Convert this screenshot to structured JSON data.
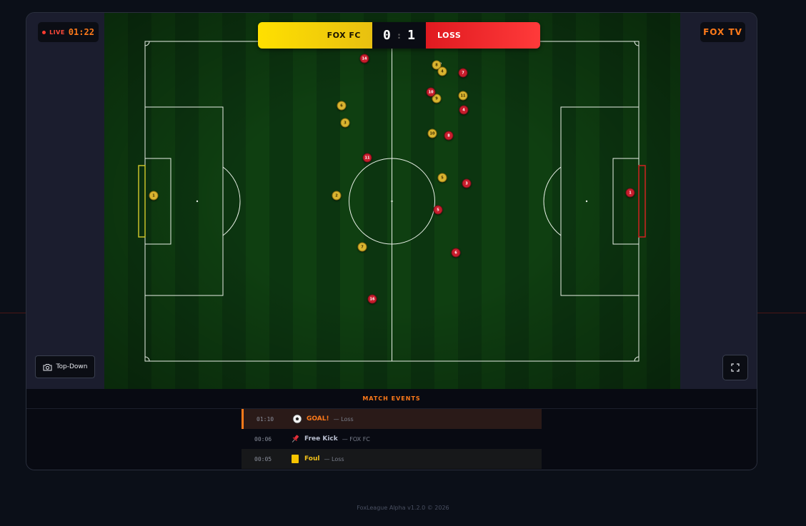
{
  "live": {
    "label": "LIVE",
    "clock": "01:22"
  },
  "broadcaster": "FOX TV",
  "scoreboard": {
    "home_team": "FOX FC",
    "home_score": "0",
    "separator": ":",
    "away_score": "1",
    "away_team": "LOSS"
  },
  "camera": {
    "label": "Top-Down",
    "icon": "camera-icon"
  },
  "fullscreen": {
    "icon": "fullscreen-icon"
  },
  "events": {
    "title": "MATCH EVENTS",
    "items": [
      {
        "time": "01:10",
        "icon": "soccer-ball-icon",
        "type": "GOAL!",
        "team": "— Loss"
      },
      {
        "time": "00:06",
        "icon": "pushpin-icon",
        "type": "Free Kick",
        "team": "— FOX FC"
      },
      {
        "time": "00:05",
        "icon": "yellow-card-icon",
        "type": "Foul",
        "team": "— Loss"
      }
    ]
  },
  "players": {
    "home": [
      "6",
      "3",
      "7",
      "8",
      "4",
      "11",
      "2",
      "5",
      "10",
      "9",
      "1"
    ],
    "away": [
      "14",
      "7",
      "10",
      "4",
      "8",
      "11",
      "3",
      "5",
      "6",
      "16",
      "1"
    ]
  },
  "colors": {
    "home": "#d9b430",
    "away": "#c81d2c",
    "accent": "#ff7a1a",
    "live": "#ff3b30"
  },
  "footer": "FoxLeague Alpha v1.2.0 © 2026"
}
